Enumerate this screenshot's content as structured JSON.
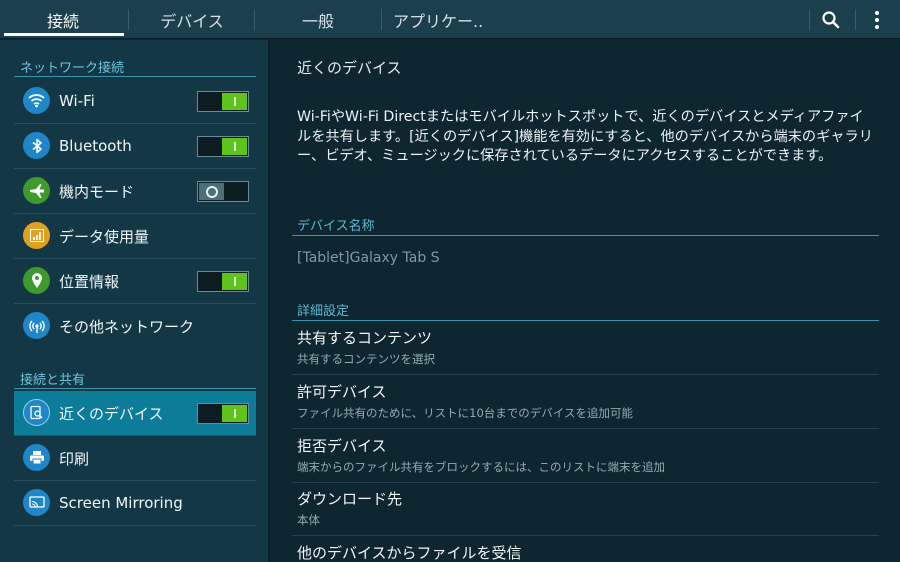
{
  "tabs": [
    {
      "label": "接続"
    },
    {
      "label": "デバイス"
    },
    {
      "label": "一般"
    },
    {
      "label": "アプリケー.."
    }
  ],
  "sidebar": {
    "section1": "ネットワーク接続",
    "section2": "接続と共有",
    "items": [
      {
        "label": "Wi-Fi",
        "icon": "wifi-icon",
        "color": "#1f86c8",
        "switch": "on"
      },
      {
        "label": "Bluetooth",
        "icon": "bluetooth-icon",
        "color": "#1f86c8",
        "switch": "on"
      },
      {
        "label": "機内モード",
        "icon": "airplane-icon",
        "color": "#3d9a2b",
        "switch": "off"
      },
      {
        "label": "データ使用量",
        "icon": "data-usage-icon",
        "color": "#e0a021",
        "switch": null
      },
      {
        "label": "位置情報",
        "icon": "location-icon",
        "color": "#3d9a2b",
        "switch": "on"
      },
      {
        "label": "その他ネットワーク",
        "icon": "network-icon",
        "color": "#1f86c8",
        "switch": null
      },
      {
        "label": "近くのデバイス",
        "icon": "nearby-devices-icon",
        "color": "#1f86c8",
        "switch": "on",
        "selected": true
      },
      {
        "label": "印刷",
        "icon": "print-icon",
        "color": "#1f86c8",
        "switch": null
      },
      {
        "label": "Screen Mirroring",
        "icon": "screen-mirroring-icon",
        "color": "#1f86c8",
        "switch": null
      }
    ]
  },
  "main": {
    "title": "近くのデバイス",
    "description": "Wi-FiやWi-Fi Directまたはモバイルホットスポットで、近くのデバイスとメディアファイルを共有します。[近くのデバイス]機能を有効にすると、他のデバイスから端末のギャラリー、ビデオ、ミュージックに保存されているデータにアクセスすることができます。",
    "device_name_header": "デバイス名称",
    "device_name": "[Tablet]Galaxy Tab S",
    "advanced_header": "詳細設定",
    "rows": [
      {
        "title": "共有するコンテンツ",
        "sub": "共有するコンテンツを選択"
      },
      {
        "title": "許可デバイス",
        "sub": "ファイル共有のために、リストに10台までのデバイスを追加可能"
      },
      {
        "title": "拒否デバイス",
        "sub": "端末からのファイル共有をブロックするには、このリストに端末を追加"
      },
      {
        "title": "ダウンロード先",
        "sub": "本体"
      },
      {
        "title": "他のデバイスからファイルを受信",
        "sub": ""
      }
    ]
  },
  "colors": {
    "accent": "#0d7c98",
    "switch_on": "#5dc41c",
    "section_header": "#6dc5dd"
  }
}
